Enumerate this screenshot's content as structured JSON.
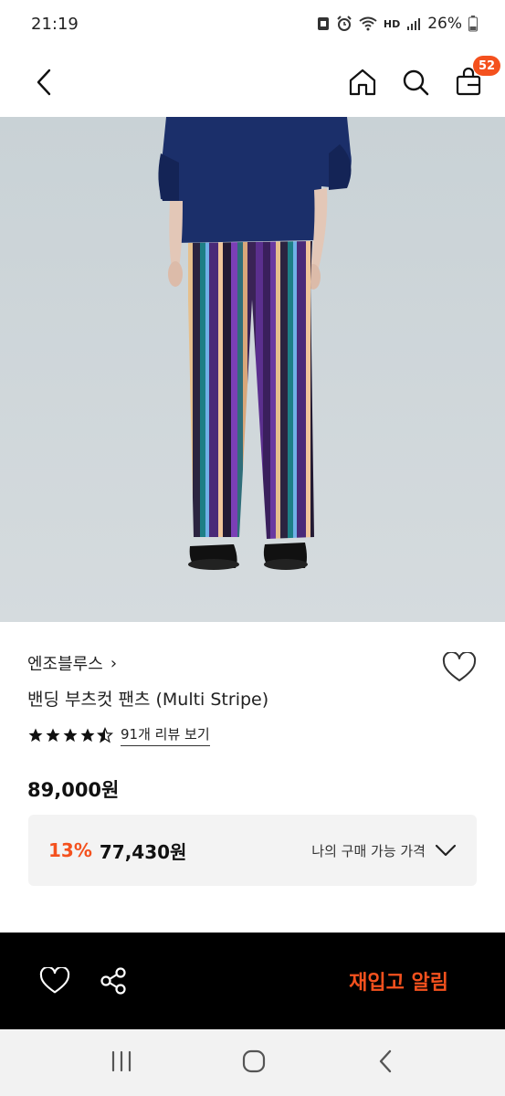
{
  "status_bar": {
    "time": "21:19",
    "network": "HD",
    "battery": "26%"
  },
  "top_nav": {
    "cart_count": "52"
  },
  "product": {
    "brand": "엔조블루스",
    "brand_chevron": "›",
    "name": "밴딩 부츠컷 팬츠 (Multi Stripe)",
    "rating": 4.5,
    "review_link": "91개 리뷰 보기",
    "price": "89,000원",
    "member": {
      "discount": "13%",
      "price": "77,430원",
      "label": "나의 구매 가능 가격"
    }
  },
  "bottom_bar": {
    "restock_label": "재입고 알림"
  },
  "colors": {
    "accent": "#f4511e",
    "bottom_bar": "#000000",
    "image_bg": "#cdd5d8",
    "shirt": "#1b2f6a"
  },
  "icons": [
    "back-arrow-icon",
    "home-icon",
    "search-icon",
    "bag-icon",
    "heart-icon",
    "share-icon",
    "chevron-down-icon",
    "recent-apps-icon",
    "home-nav-icon",
    "back-nav-icon"
  ]
}
